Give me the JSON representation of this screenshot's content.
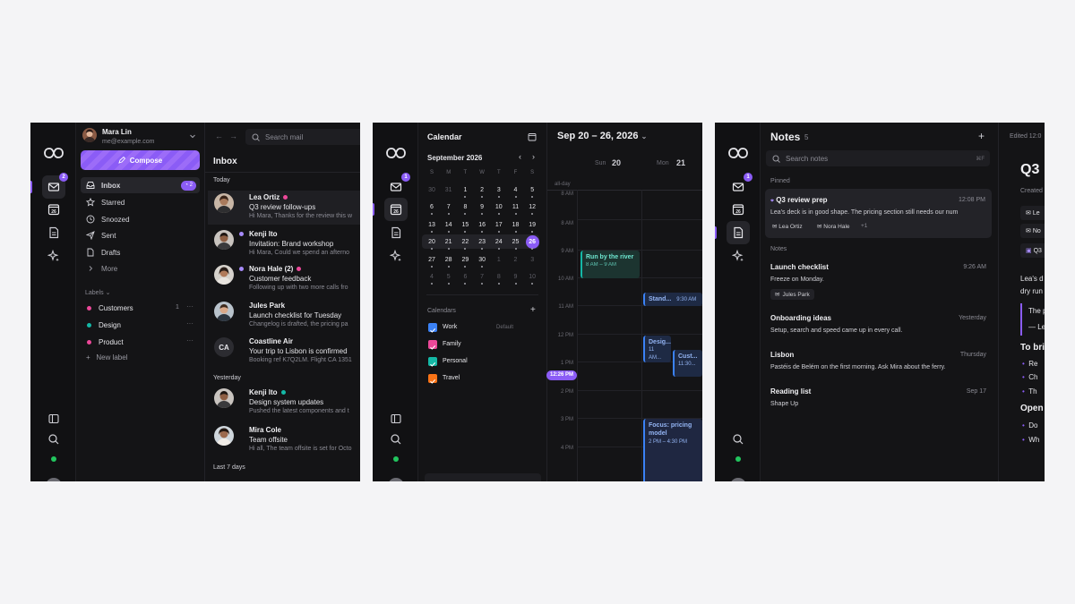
{
  "colors": {
    "accent": "#8b5cf6",
    "green": "#22c55e",
    "pink": "#ec4899",
    "teal": "#14b8a6",
    "work": "#3b82f6",
    "travel": "#f97316"
  },
  "mail": {
    "user": {
      "name": "Mara Lin",
      "email": "me@example.com"
    },
    "rail_badge": "2",
    "compose": "Compose",
    "nav": [
      {
        "label": "Inbox",
        "count": "2",
        "icon": "inbox-icon"
      },
      {
        "label": "Starred",
        "icon": "star-icon"
      },
      {
        "label": "Snoozed",
        "icon": "clock-icon"
      },
      {
        "label": "Sent",
        "icon": "send-icon"
      },
      {
        "label": "Drafts",
        "icon": "file-icon"
      },
      {
        "label": "More",
        "icon": "chevron-right-icon"
      }
    ],
    "labels_heading": "Labels",
    "labels": [
      {
        "name": "Customers",
        "count": "1",
        "color": "#ec4899"
      },
      {
        "name": "Design",
        "color": "#14b8a6"
      },
      {
        "name": "Product",
        "color": "#ec4899"
      }
    ],
    "new_label": "New label",
    "search_placeholder": "Search mail",
    "title": "Inbox",
    "groups": {
      "today": "Today",
      "yesterday": "Yesterday",
      "last7": "Last 7 days"
    },
    "messages": [
      {
        "from": "Lea Ortiz",
        "subject": "Q3 review follow-ups",
        "preview": "Hi Mara, Thanks for the review this w",
        "label_color": "#ec4899"
      },
      {
        "from": "Kenji Ito",
        "subject": "Invitation: Brand workshop",
        "preview": "Hi Mara, Could we spend an afterno"
      },
      {
        "from": "Nora Hale (2)",
        "subject": "Customer feedback",
        "preview": "Following up with two more calls fro",
        "label_color": "#ec4899"
      },
      {
        "from": "Jules Park",
        "subject": "Launch checklist for Tuesday",
        "preview": "Changelog is drafted, the pricing pa"
      },
      {
        "from": "Coastline Air",
        "initials": "CA",
        "subject": "Your trip to Lisbon is confirmed",
        "preview": "Booking ref K7Q2LM. Flight CA 1351"
      },
      {
        "from": "Kenji Ito",
        "subject": "Design system updates",
        "preview": "Pushed the latest components and t",
        "label_color": "#14b8a6"
      },
      {
        "from": "Mira Cole",
        "subject": "Team offsite",
        "preview": "Hi all, The team offsite is set for Octo"
      }
    ]
  },
  "calendar": {
    "rail_badge": "1",
    "rail_date": "26",
    "title": "Calendar",
    "month": "September 2026",
    "weekdays": [
      "S",
      "M",
      "T",
      "W",
      "T",
      "F",
      "S"
    ],
    "weeks": [
      [
        "30",
        "31",
        "1",
        "2",
        "3",
        "4",
        "5"
      ],
      [
        "6",
        "7",
        "8",
        "9",
        "10",
        "11",
        "12"
      ],
      [
        "13",
        "14",
        "15",
        "16",
        "17",
        "18",
        "19"
      ],
      [
        "20",
        "21",
        "22",
        "23",
        "24",
        "25",
        "26"
      ],
      [
        "27",
        "28",
        "29",
        "30",
        "1",
        "2",
        "3"
      ],
      [
        "4",
        "5",
        "6",
        "7",
        "8",
        "9",
        "10"
      ]
    ],
    "calendars_heading": "Calendars",
    "calendars": [
      {
        "name": "Work",
        "note": "Default",
        "color": "#3b82f6"
      },
      {
        "name": "Family",
        "color": "#ec4899"
      },
      {
        "name": "Personal",
        "color": "#14b8a6"
      },
      {
        "name": "Travel",
        "color": "#f97316"
      }
    ],
    "range": "Sep 20 – 26, 2026",
    "days": [
      {
        "dow": "Sun",
        "num": "20"
      },
      {
        "dow": "Mon",
        "num": "21"
      }
    ],
    "allday": "all-day",
    "hours": [
      "8 AM",
      "9 AM",
      "10 AM",
      "11 AM",
      "12 PM",
      "1 PM",
      "2 PM",
      "3 PM",
      "4 PM"
    ],
    "top_hour": "8 AM",
    "now": "12:26 PM",
    "events": [
      {
        "title": "Run by the river",
        "time": "8 AM – 9 AM"
      },
      {
        "title": "Stand...",
        "time": "9:30 AM"
      },
      {
        "title": "Desig...",
        "time": "11 AM..."
      },
      {
        "title": "Cust...",
        "time": "11:30..."
      },
      {
        "title": "Focus: pricing model",
        "time": "2 PM – 4:30 PM"
      }
    ]
  },
  "notes": {
    "title": "Notes",
    "count": "5",
    "search_placeholder": "Search notes",
    "search_shortcut": "⌘F",
    "pinned_heading": "Pinned",
    "notes_heading": "Notes",
    "pinned": {
      "title": "Q3 review prep",
      "date": "12:08 PM",
      "body": "Lea's deck is in good shape. The pricing section still needs our num",
      "people": [
        "Lea Ortiz",
        "Nora Hale"
      ],
      "more": "+1"
    },
    "items": [
      {
        "title": "Launch checklist",
        "date": "9:26 AM",
        "body": "Freeze on Monday.",
        "tag": "Jules Park"
      },
      {
        "title": "Onboarding ideas",
        "date": "Yesterday",
        "body": "Setup, search and speed came up in every call."
      },
      {
        "title": "Lisbon",
        "date": "Thursday",
        "body": "Pastéis de Belém on the first morning. Ask Mira about the ferry."
      },
      {
        "title": "Reading list",
        "date": "Sep 17",
        "body": "Shape Up"
      }
    ],
    "detail": {
      "edited": "Edited 12:0",
      "title": "Q3",
      "created": "Created",
      "rows": [
        "Le",
        "No",
        "Q3"
      ],
      "body1": "Lea's d",
      "body2": "dry run",
      "quote1": "The p",
      "quote2": "— Le",
      "heading1": "To bri",
      "bullets1": [
        "Re",
        "Ch",
        "Th"
      ],
      "heading2": "Open",
      "bullets2": [
        "Do",
        "Wh"
      ]
    }
  }
}
